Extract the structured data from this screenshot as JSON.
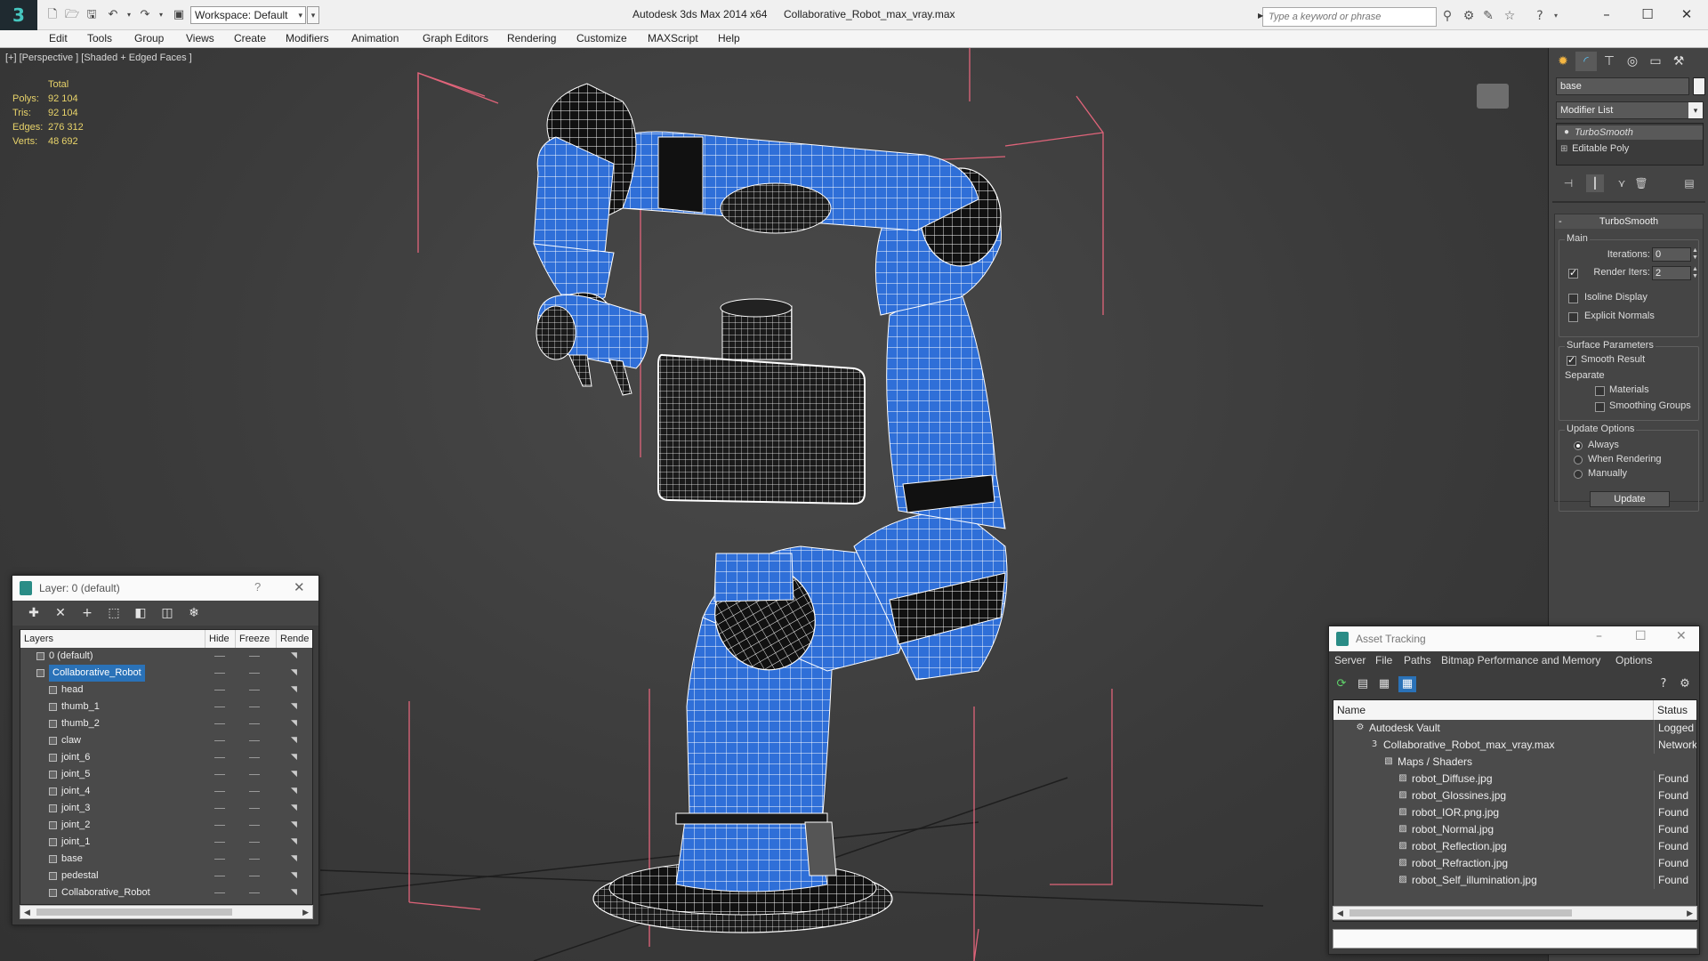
{
  "titlebar": {
    "workspace": "Workspace: Default",
    "app_title": "Autodesk 3ds Max  2014 x64",
    "file_title": "Collaborative_Robot_max_vray.max",
    "search_placeholder": "Type a keyword or phrase",
    "window_controls": [
      "minimize",
      "maximize",
      "close"
    ]
  },
  "menubar": [
    "Edit",
    "Tools",
    "Group",
    "Views",
    "Create",
    "Modifiers",
    "Animation",
    "Graph Editors",
    "Rendering",
    "Customize",
    "MAXScript",
    "Help"
  ],
  "viewport": {
    "label": "[+] [Perspective ] [Shaded + Edged Faces ]",
    "stats": {
      "header": "Total",
      "rows": [
        {
          "key": "Polys:",
          "value": "92 104"
        },
        {
          "key": "Tris:",
          "value": "92 104"
        },
        {
          "key": "Edges:",
          "value": "276 312"
        },
        {
          "key": "Verts:",
          "value": "48 692"
        }
      ]
    },
    "colors": {
      "wire": "#ffffff",
      "blue": "#2f6fd8",
      "black": "#111111",
      "bbox": "#e0647a"
    }
  },
  "command_panel": {
    "object_name": "base",
    "modifier_list": "Modifier List",
    "stack": [
      "TurboSmooth",
      "Editable Poly"
    ],
    "rollout_title": "TurboSmooth",
    "main": {
      "label": "Main",
      "iterations_label": "Iterations:",
      "iterations_value": "0",
      "render_iters_label": "Render Iters:",
      "render_iters_value": "2",
      "render_iters_checked": true,
      "isoline": "Isoline Display",
      "isoline_checked": false,
      "explicit": "Explicit Normals",
      "explicit_checked": false
    },
    "surface": {
      "label": "Surface Parameters",
      "smooth": "Smooth Result",
      "smooth_checked": true,
      "separate": "Separate",
      "materials": "Materials",
      "smoothing_groups": "Smoothing Groups"
    },
    "update": {
      "label": "Update Options",
      "always": "Always",
      "when_rendering": "When Rendering",
      "manually": "Manually",
      "selected": "Always",
      "button": "Update"
    }
  },
  "layer_dialog": {
    "title": "Layer: 0 (default)",
    "help": "?",
    "columns": [
      "Layers",
      "Hide",
      "Freeze",
      "Rende"
    ],
    "rows": [
      {
        "name": "0 (default)",
        "level": 0,
        "selected": false
      },
      {
        "name": "Collaborative_Robot",
        "level": 0,
        "selected": true
      },
      {
        "name": "head",
        "level": 1
      },
      {
        "name": "thumb_1",
        "level": 1
      },
      {
        "name": "thumb_2",
        "level": 1
      },
      {
        "name": "claw",
        "level": 1
      },
      {
        "name": "joint_6",
        "level": 1
      },
      {
        "name": "joint_5",
        "level": 1
      },
      {
        "name": "joint_4",
        "level": 1
      },
      {
        "name": "joint_3",
        "level": 1
      },
      {
        "name": "joint_2",
        "level": 1
      },
      {
        "name": "joint_1",
        "level": 1
      },
      {
        "name": "base",
        "level": 1
      },
      {
        "name": "pedestal",
        "level": 1
      },
      {
        "name": "Collaborative_Robot",
        "level": 1
      }
    ]
  },
  "asset_dialog": {
    "title": "Asset Tracking",
    "menu": [
      "Server",
      "File",
      "Paths",
      "Bitmap Performance and Memory",
      "Options"
    ],
    "columns": [
      "Name",
      "Status"
    ],
    "rows": [
      {
        "name": "Autodesk Vault",
        "level": 1,
        "status": "Logged O",
        "icon": "vault-icon"
      },
      {
        "name": "Collaborative_Robot_max_vray.max",
        "level": 2,
        "status": "Network F",
        "icon": "max-file-icon"
      },
      {
        "name": "Maps / Shaders",
        "level": 3,
        "status": "",
        "icon": "maps-icon"
      },
      {
        "name": "robot_Diffuse.jpg",
        "level": 4,
        "status": "Found",
        "icon": "bitmap-icon"
      },
      {
        "name": "robot_Glossines.jpg",
        "level": 4,
        "status": "Found",
        "icon": "bitmap-icon"
      },
      {
        "name": "robot_IOR.png.jpg",
        "level": 4,
        "status": "Found",
        "icon": "bitmap-icon"
      },
      {
        "name": "robot_Normal.jpg",
        "level": 4,
        "status": "Found",
        "icon": "bitmap-icon"
      },
      {
        "name": "robot_Reflection.jpg",
        "level": 4,
        "status": "Found",
        "icon": "bitmap-icon"
      },
      {
        "name": "robot_Refraction.jpg",
        "level": 4,
        "status": "Found",
        "icon": "bitmap-icon"
      },
      {
        "name": "robot_Self_illumination.jpg",
        "level": 4,
        "status": "Found",
        "icon": "bitmap-icon"
      }
    ]
  }
}
